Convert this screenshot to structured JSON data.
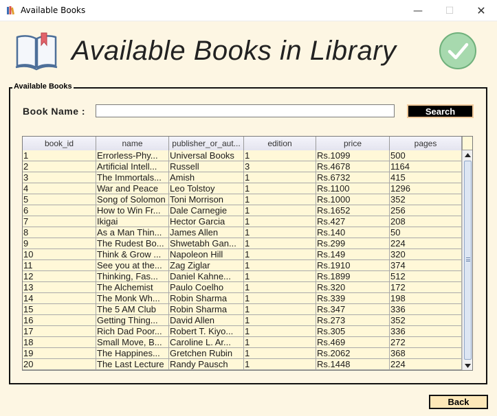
{
  "window": {
    "title": "Available Books",
    "min_glyph": "—",
    "max_glyph": "☐",
    "close_glyph": "✕",
    "icon": "books-app-icon"
  },
  "header": {
    "heading": "Available Books in Library",
    "left_icon": "open-book-icon",
    "right_icon": "check-circle-icon"
  },
  "panel": {
    "legend": "Available Books",
    "search_label": "Book Name :",
    "search_value": "",
    "search_button": "Search"
  },
  "table": {
    "columns": [
      "book_id",
      "name",
      "publisher_or_aut...",
      "edition",
      "price",
      "pages"
    ],
    "rows": [
      [
        "1",
        "Errorless-Phy...",
        "Universal Books",
        "1",
        "Rs.1099",
        "500"
      ],
      [
        "2",
        "Artificial Intell...",
        "Russell",
        "3",
        "Rs.4678",
        "1164"
      ],
      [
        "3",
        "The Immortals...",
        "Amish",
        "1",
        "Rs.6732",
        "415"
      ],
      [
        "4",
        "War and Peace",
        "Leo Tolstoy",
        "1",
        "Rs.1100",
        "1296"
      ],
      [
        "5",
        "Song of Solomon",
        "Toni Morrison",
        "1",
        "Rs.1000",
        "352"
      ],
      [
        "6",
        "How to Win Fr...",
        "Dale Carnegie",
        "1",
        "Rs.1652",
        "256"
      ],
      [
        "7",
        "Ikigai",
        "Hector Garcia",
        "1",
        "Rs.427",
        "208"
      ],
      [
        "8",
        "As a Man Thin...",
        "James Allen",
        "1",
        "Rs.140",
        "50"
      ],
      [
        "9",
        "The Rudest Bo...",
        "Shwetabh Gan...",
        "1",
        "Rs.299",
        "224"
      ],
      [
        "10",
        "Think & Grow ...",
        "Napoleon Hill",
        "1",
        "Rs.149",
        "320"
      ],
      [
        "11",
        "See you at the...",
        "Zag Ziglar",
        "1",
        "Rs.1910",
        "374"
      ],
      [
        "12",
        "Thinking, Fas...",
        "Daniel Kahne...",
        "1",
        "Rs.1899",
        "512"
      ],
      [
        "13",
        "The Alchemist",
        "Paulo Coelho",
        "1",
        "Rs.320",
        "172"
      ],
      [
        "14",
        "The Monk Wh...",
        "Robin Sharma",
        "1",
        "Rs.339",
        "198"
      ],
      [
        "15",
        "The 5 AM Club",
        "Robin Sharma",
        "1",
        "Rs.347",
        "336"
      ],
      [
        "16",
        "Getting Thing...",
        "David Allen",
        "1",
        "Rs.273",
        "352"
      ],
      [
        "17",
        "Rich Dad Poor...",
        "Robert T. Kiyo...",
        "1",
        "Rs.305",
        "336"
      ],
      [
        "18",
        "Small Move, B...",
        " Caroline L. Ar...",
        "1",
        "Rs.469",
        "272"
      ],
      [
        "19",
        "The Happines...",
        "Gretchen Rubin",
        "1",
        "Rs.2062",
        "368"
      ],
      [
        "20",
        "The Last Lecture",
        "Randy Pausch",
        "1",
        "Rs.1448",
        "224"
      ]
    ]
  },
  "footer": {
    "back_button": "Back"
  },
  "colors": {
    "background": "#fdf6e3",
    "table_background": "#fff8d8",
    "search_button_bg": "#000000",
    "back_button_bg": "#fde8b8",
    "check_circle": "#8fd19e"
  }
}
